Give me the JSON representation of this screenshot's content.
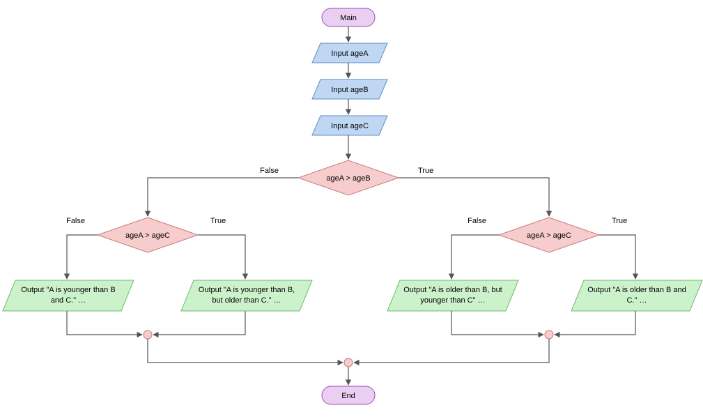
{
  "chart_data": {
    "type": "flowchart",
    "nodes": [
      {
        "id": "main",
        "kind": "terminal",
        "label": "Main"
      },
      {
        "id": "inA",
        "kind": "io",
        "label": "Input ageA"
      },
      {
        "id": "inB",
        "kind": "io",
        "label": "Input ageB"
      },
      {
        "id": "inC",
        "kind": "io",
        "label": "Input ageC"
      },
      {
        "id": "d1",
        "kind": "decision",
        "label": "ageA > ageB"
      },
      {
        "id": "d2L",
        "kind": "decision",
        "label": "ageA > ageC"
      },
      {
        "id": "d2R",
        "kind": "decision",
        "label": "ageA > ageC"
      },
      {
        "id": "o1",
        "kind": "io-out",
        "label": "Output \"A is younger than B and C.\" …"
      },
      {
        "id": "o2",
        "kind": "io-out",
        "label": "Output \"A is younger than B, but older than C.\" …"
      },
      {
        "id": "o3",
        "kind": "io-out",
        "label": "Output \"A is older than B, but younger than C\" …"
      },
      {
        "id": "o4",
        "kind": "io-out",
        "label": "Output \"A is older than B and C.\" …"
      },
      {
        "id": "end",
        "kind": "terminal",
        "label": "End"
      }
    ],
    "edges": [
      {
        "from": "main",
        "to": "inA"
      },
      {
        "from": "inA",
        "to": "inB"
      },
      {
        "from": "inB",
        "to": "inC"
      },
      {
        "from": "inC",
        "to": "d1"
      },
      {
        "from": "d1",
        "to": "d2L",
        "label": "False"
      },
      {
        "from": "d1",
        "to": "d2R",
        "label": "True"
      },
      {
        "from": "d2L",
        "to": "o1",
        "label": "False"
      },
      {
        "from": "d2L",
        "to": "o2",
        "label": "True"
      },
      {
        "from": "d2R",
        "to": "o3",
        "label": "False"
      },
      {
        "from": "d2R",
        "to": "o4",
        "label": "True"
      },
      {
        "from": "o1",
        "to": "mergeL"
      },
      {
        "from": "o2",
        "to": "mergeL"
      },
      {
        "from": "mergeL",
        "to": "mergeC"
      },
      {
        "from": "o3",
        "to": "mergeR"
      },
      {
        "from": "o4",
        "to": "mergeR"
      },
      {
        "from": "mergeR",
        "to": "mergeC"
      },
      {
        "from": "mergeC",
        "to": "end"
      }
    ]
  },
  "colors": {
    "terminal_fill": "#EBCFF2",
    "terminal_stroke": "#9B4FB0",
    "io_fill": "#BFD7F2",
    "io_stroke": "#5B8FC7",
    "decision_fill": "#F6CCCC",
    "decision_stroke": "#C77A7A",
    "output_fill": "#CCF2CC",
    "output_stroke": "#6FB86F",
    "merge_fill": "#F6CCCC",
    "merge_stroke": "#C77A7A"
  },
  "labels": {
    "main": "Main",
    "inA": "Input ageA",
    "inB": "Input ageB",
    "inC": "Input ageC",
    "d1": "ageA > ageB",
    "d2L": "ageA > ageC",
    "d2R": "ageA > ageC",
    "o1a": "Output \"A is younger than B",
    "o1b": "and C.\" …",
    "o2a": "Output \"A is younger than B,",
    "o2b": "but older than C.\" …",
    "o3a": "Output \"A is older than B, but",
    "o3b": "younger than C\" …",
    "o4a": "Output \"A is older than B and",
    "o4b": "C.\" …",
    "end": "End",
    "false": "False",
    "true": "True"
  }
}
